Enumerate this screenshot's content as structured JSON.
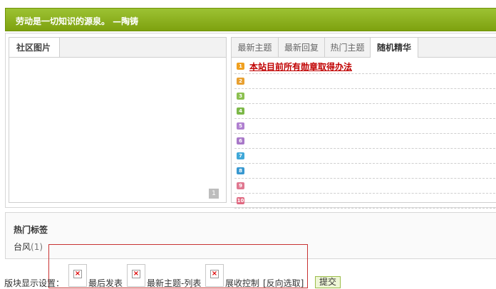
{
  "banner": {
    "quote": "劳动是一切知识的源泉。 —陶铸"
  },
  "left_panel": {
    "tab": "社区图片",
    "pager": "1"
  },
  "right_panel": {
    "tabs": [
      "最新主题",
      "最新回复",
      "热门主题",
      "随机精华"
    ],
    "active_tab": "随机精华",
    "items": [
      {
        "num": "1",
        "title": "本站目前所有勋章取得办法",
        "color": "#f0a020"
      },
      {
        "num": "2",
        "title": "",
        "color": "#e8a030"
      },
      {
        "num": "3",
        "title": "",
        "color": "#8cc050"
      },
      {
        "num": "4",
        "title": "",
        "color": "#7cb848"
      },
      {
        "num": "5",
        "title": "",
        "color": "#b080d0"
      },
      {
        "num": "6",
        "title": "",
        "color": "#a878c8"
      },
      {
        "num": "7",
        "title": "",
        "color": "#40a8d8"
      },
      {
        "num": "8",
        "title": "",
        "color": "#3898d0"
      },
      {
        "num": "9",
        "title": "",
        "color": "#e07890"
      },
      {
        "num": "10",
        "title": "",
        "color": "#e06880"
      }
    ]
  },
  "hot_tags": {
    "title": "热门标签",
    "tags": [
      {
        "name": "台风",
        "count": "(1)"
      }
    ]
  },
  "settings": {
    "label": "版块显示设置：",
    "options": [
      "最后发表",
      "最新主题-列表",
      "展收控制"
    ],
    "invert": "[反向选取]",
    "submit": "提交"
  }
}
